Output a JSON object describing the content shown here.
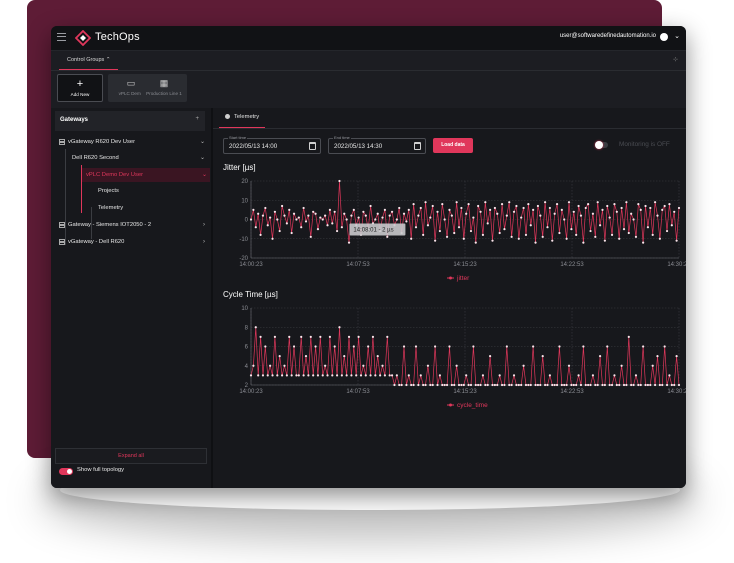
{
  "app": {
    "title": "TechOps",
    "user_email": "user@softwaredefinedautomation.io"
  },
  "colors": {
    "accent": "#e0375b",
    "backdrop": "#5e1c36",
    "background": "#17181c"
  },
  "control_groups": {
    "tab_label": "Control Groups",
    "devices": [
      {
        "label": "Add New",
        "icon": "plus-icon"
      },
      {
        "label": "vPLC Demo",
        "icon": "plc-icon"
      },
      {
        "label": "Production Line 1",
        "icon": "production-line-icon"
      }
    ]
  },
  "sidebar": {
    "title": "Gateways",
    "tree": [
      {
        "label": "vGateway R620 Dev User",
        "icon": "gateway-icon"
      },
      {
        "label": "Dell R620 Second"
      },
      {
        "label": "vPLC Demo Dev User"
      },
      {
        "label": "Projects"
      },
      {
        "label": "Telemetry"
      },
      {
        "label": "Gateway - Siemens IOT2050 - 2",
        "icon": "gateway-icon"
      },
      {
        "label": "vGateway - Dell R620",
        "icon": "gateway-icon"
      }
    ],
    "expand_all": "Expand all",
    "show_topology": "Show full topology"
  },
  "telemetry": {
    "tab_label": "Telemetry",
    "start_label": "Start time",
    "start_value": "2022/05/13 14:00",
    "end_label": "End time",
    "end_value": "2022/05/13 14:30",
    "load_button": "Load data",
    "monitoring_label": "Monitoring is OFF",
    "jitter_title": "Jitter [µs]",
    "cycle_title": "Cycle Time [µs]",
    "tooltip": "14:08:01 - 2 µs"
  },
  "chart_data": [
    {
      "type": "line",
      "title": "Jitter [µs]",
      "x_ticks": [
        "14:00:23",
        "14:07:53",
        "14:15:23",
        "14:22:53",
        "14:30:20"
      ],
      "y_ticks": [
        20,
        10,
        0,
        -10,
        -20
      ],
      "ylim": [
        -20,
        20
      ],
      "grid": true,
      "legend_position": "bottom",
      "series": [
        {
          "name": "jitter",
          "values": [
            0,
            5,
            -4,
            3,
            -8,
            2,
            6,
            -3,
            1,
            -10,
            4,
            0,
            -6,
            7,
            2,
            -2,
            5,
            -7,
            3,
            0,
            1,
            -4,
            6,
            -1,
            2,
            -9,
            4,
            3,
            -5,
            1,
            0,
            2,
            -3,
            5,
            -2,
            4,
            -6,
            20,
            -4,
            3,
            0,
            -12,
            2,
            5,
            -3,
            1,
            -8,
            4,
            2,
            -5,
            7,
            -2,
            0,
            3,
            -6,
            1,
            5,
            -9,
            2,
            4,
            -3,
            0,
            6,
            -7,
            3,
            -1,
            5,
            -10,
            8,
            -4,
            2,
            6,
            -8,
            9,
            -3,
            1,
            7,
            -11,
            4,
            -6,
            8,
            0,
            -9,
            5,
            2,
            -7,
            9,
            -4,
            6,
            -10,
            3,
            8,
            -6,
            1,
            -12,
            7,
            4,
            -8,
            9,
            -2,
            5,
            -11,
            6,
            3,
            -7,
            8,
            -5,
            2,
            9,
            -9,
            4,
            7,
            -10,
            1,
            6,
            -8,
            8,
            -3,
            5,
            -12,
            7,
            2,
            -9,
            9,
            -4,
            6,
            -11,
            3,
            8,
            -7,
            5,
            0,
            -10,
            9,
            -5,
            4,
            -8,
            7,
            2,
            -12,
            6,
            8,
            -6,
            3,
            -9,
            9,
            -3,
            5,
            -11,
            7,
            1,
            -8,
            8,
            4,
            -10,
            6,
            -5,
            9,
            -7,
            3,
            0,
            -9,
            8,
            5,
            -12,
            7,
            -4,
            6,
            -8,
            9,
            2,
            -10,
            5,
            7,
            -6,
            8,
            -3,
            4,
            -11,
            6
          ]
        }
      ]
    },
    {
      "type": "line",
      "title": "Cycle Time [µs]",
      "x_ticks": [
        "14:00:23",
        "14:07:53",
        "14:15:23",
        "14:22:53",
        "14:30:20"
      ],
      "y_ticks": [
        10,
        8,
        6,
        4,
        2
      ],
      "ylim": [
        2,
        10
      ],
      "grid": true,
      "legend_position": "bottom",
      "series": [
        {
          "name": "cycle_time",
          "values": [
            3,
            4,
            8,
            3,
            7,
            3,
            6,
            3,
            4,
            3,
            7,
            3,
            5,
            3,
            4,
            3,
            7,
            3,
            6,
            3,
            3,
            7,
            3,
            5,
            3,
            7,
            3,
            6,
            3,
            7,
            3,
            4,
            3,
            7,
            3,
            6,
            3,
            8,
            3,
            5,
            3,
            7,
            3,
            6,
            3,
            7,
            3,
            4,
            3,
            6,
            3,
            7,
            3,
            5,
            3,
            4,
            3,
            7,
            3,
            3,
            2,
            3,
            2,
            2,
            6,
            2,
            3,
            2,
            2,
            6,
            2,
            3,
            2,
            2,
            4,
            2,
            2,
            6,
            2,
            3,
            2,
            2,
            2,
            6,
            2,
            2,
            4,
            2,
            2,
            2,
            3,
            2,
            2,
            6,
            2,
            2,
            2,
            3,
            2,
            2,
            5,
            2,
            2,
            2,
            3,
            2,
            2,
            6,
            2,
            2,
            3,
            2,
            2,
            2,
            4,
            2,
            2,
            2,
            6,
            2,
            2,
            2,
            5,
            2,
            2,
            3,
            2,
            2,
            2,
            6,
            2,
            2,
            2,
            4,
            2,
            2,
            2,
            3,
            2,
            6,
            2,
            2,
            2,
            3,
            2,
            2,
            5,
            2,
            2,
            6,
            2,
            2,
            3,
            2,
            2,
            4,
            2,
            2,
            7,
            2,
            2,
            3,
            2,
            2,
            6,
            2,
            2,
            2,
            4,
            2,
            5,
            2,
            2,
            6,
            2,
            3,
            2,
            2,
            5,
            2
          ]
        }
      ]
    }
  ]
}
